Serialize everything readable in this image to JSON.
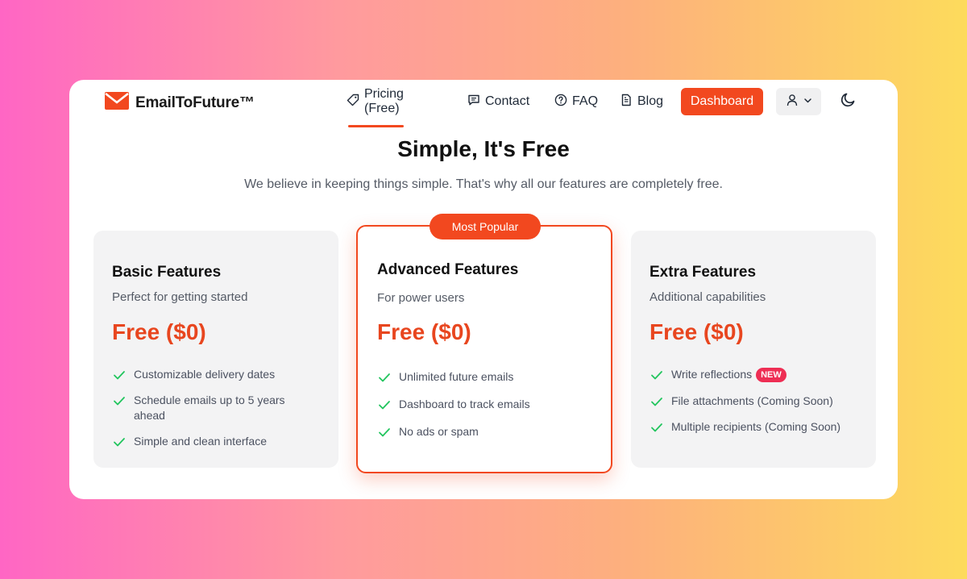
{
  "brand": {
    "name": "EmailToFuture™",
    "logo_icon": "envelope-icon",
    "accent": "#f2481f"
  },
  "nav": {
    "items": [
      {
        "label": "Pricing (Free)",
        "icon": "tag-icon",
        "active": true
      },
      {
        "label": "Contact",
        "icon": "message-square-icon"
      },
      {
        "label": "FAQ",
        "icon": "help-circle-icon"
      },
      {
        "label": "Blog",
        "icon": "document-icon"
      }
    ],
    "dashboard_label": "Dashboard",
    "user_icon": "user-icon",
    "theme_icon": "moon-icon"
  },
  "hero": {
    "title": "Simple, It's Free",
    "subtitle": "We believe in keeping things simple. That's why all our features are completely free."
  },
  "plans": [
    {
      "name": "Basic Features",
      "description": "Perfect for getting started",
      "price": "Free ($0)",
      "features": [
        "Customizable delivery dates",
        "Schedule emails up to 5 years ahead",
        "Simple and clean interface"
      ]
    },
    {
      "name": "Advanced Features",
      "description": "For power users",
      "price": "Free ($0)",
      "badge": "Most Popular",
      "features": [
        "Unlimited future emails",
        "Dashboard to track emails",
        "No ads or spam"
      ]
    },
    {
      "name": "Extra Features",
      "description": "Additional capabilities",
      "price": "Free ($0)",
      "features": [
        "Write reflections",
        "File attachments (Coming Soon)",
        "Multiple recipients (Coming Soon)"
      ],
      "new_badge": "NEW"
    }
  ],
  "colors": {
    "accent": "#f2481f",
    "check": "#22c55e",
    "new_badge": "#ee2e54"
  }
}
